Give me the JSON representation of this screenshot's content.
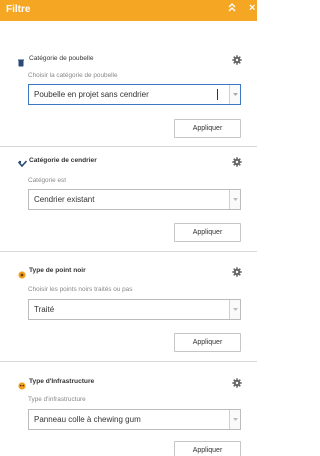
{
  "header": {
    "title": "Filtre",
    "collapse_icon": "double-chevron-up-icon",
    "close_icon": "close-icon",
    "background_color": "#f5a623"
  },
  "filters": [
    {
      "title": "Catégorie de poubelle",
      "title_bold": false,
      "icon": "trash-bin-icon",
      "description": "Choisir la catégorie de poubelle",
      "value": "Poubelle en projet sans cendrier",
      "apply_label": "Appliquer",
      "active": true
    },
    {
      "title": "Catégorie de cendrier",
      "title_bold": true,
      "icon": "ashtray-icon",
      "description": "Catégorie est",
      "value": "Cendrier existant",
      "apply_label": "Appliquer",
      "active": false
    },
    {
      "title": "Type de point noir",
      "title_bold": true,
      "icon": "orange-dot-icon",
      "description": "Choisir les points noirs traités ou pas",
      "value": "Traité",
      "apply_label": "Appliquer",
      "active": false
    },
    {
      "title": "Type d'Infrastructure",
      "title_bold": true,
      "icon": "orange-face-icon",
      "description": "Type d'infrastructure",
      "value": "Panneau colle à chewing gum",
      "apply_label": "Appliquer",
      "active": false
    }
  ]
}
